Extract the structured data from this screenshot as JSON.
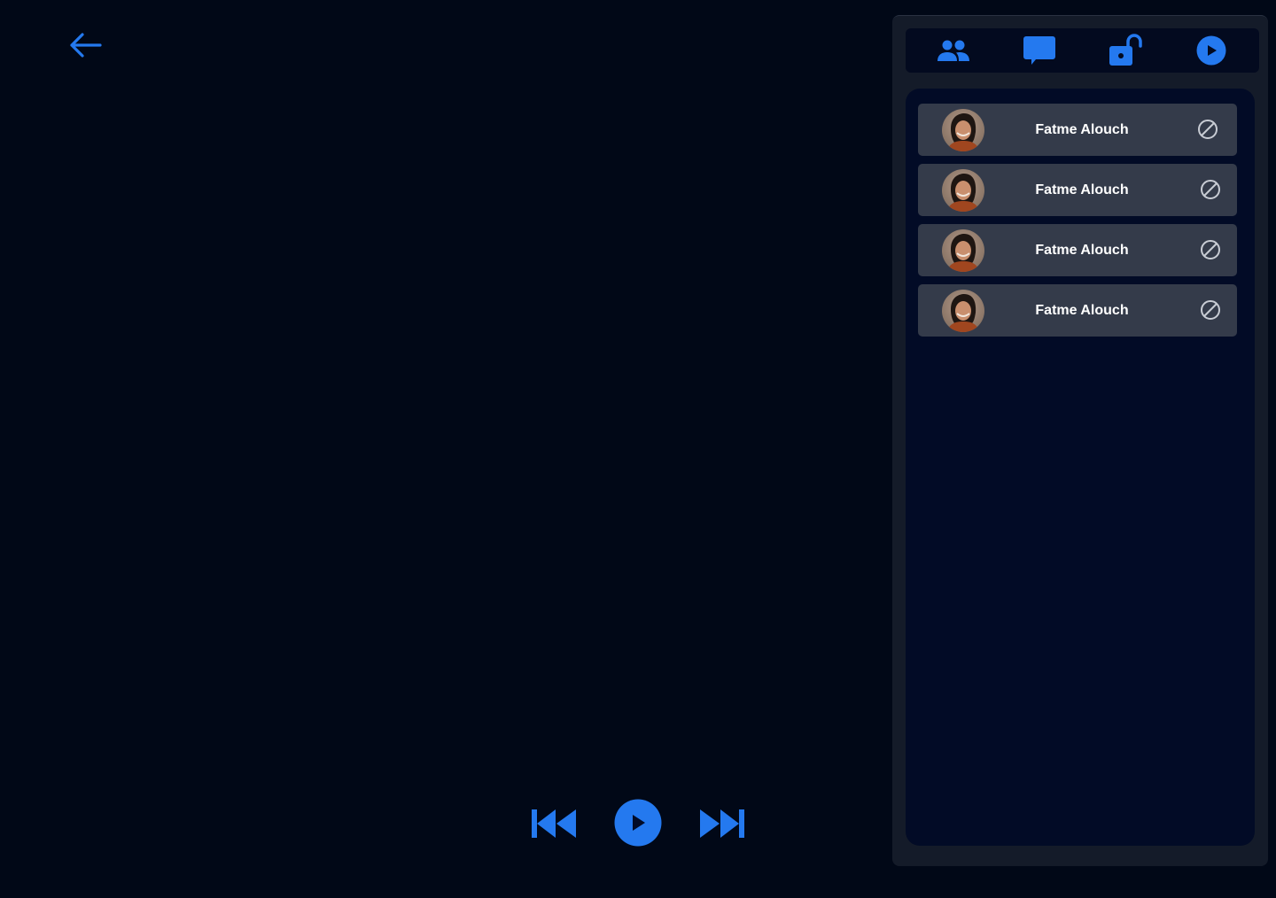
{
  "colors": {
    "background": "#010817",
    "accent": "#2479ef",
    "panel": "#141b29",
    "tabbar": "#030a1f",
    "list_area": "#020b26",
    "row": "#343b4a",
    "row_text": "#ffffff",
    "block_icon": "#c8ccd4"
  },
  "back_icon": "arrow-left-icon",
  "player": {
    "prev_icon": "skip-previous-icon",
    "play_icon": "play-circle-icon",
    "next_icon": "skip-next-icon"
  },
  "tabs": [
    {
      "icon": "people-icon"
    },
    {
      "icon": "chat-icon"
    },
    {
      "icon": "lock-open-icon"
    },
    {
      "icon": "play-circle-icon"
    }
  ],
  "participants": [
    {
      "name": "Fatme Alouch",
      "action_icon": "block-icon"
    },
    {
      "name": "Fatme Alouch",
      "action_icon": "block-icon"
    },
    {
      "name": "Fatme Alouch",
      "action_icon": "block-icon"
    },
    {
      "name": "Fatme Alouch",
      "action_icon": "block-icon"
    }
  ]
}
